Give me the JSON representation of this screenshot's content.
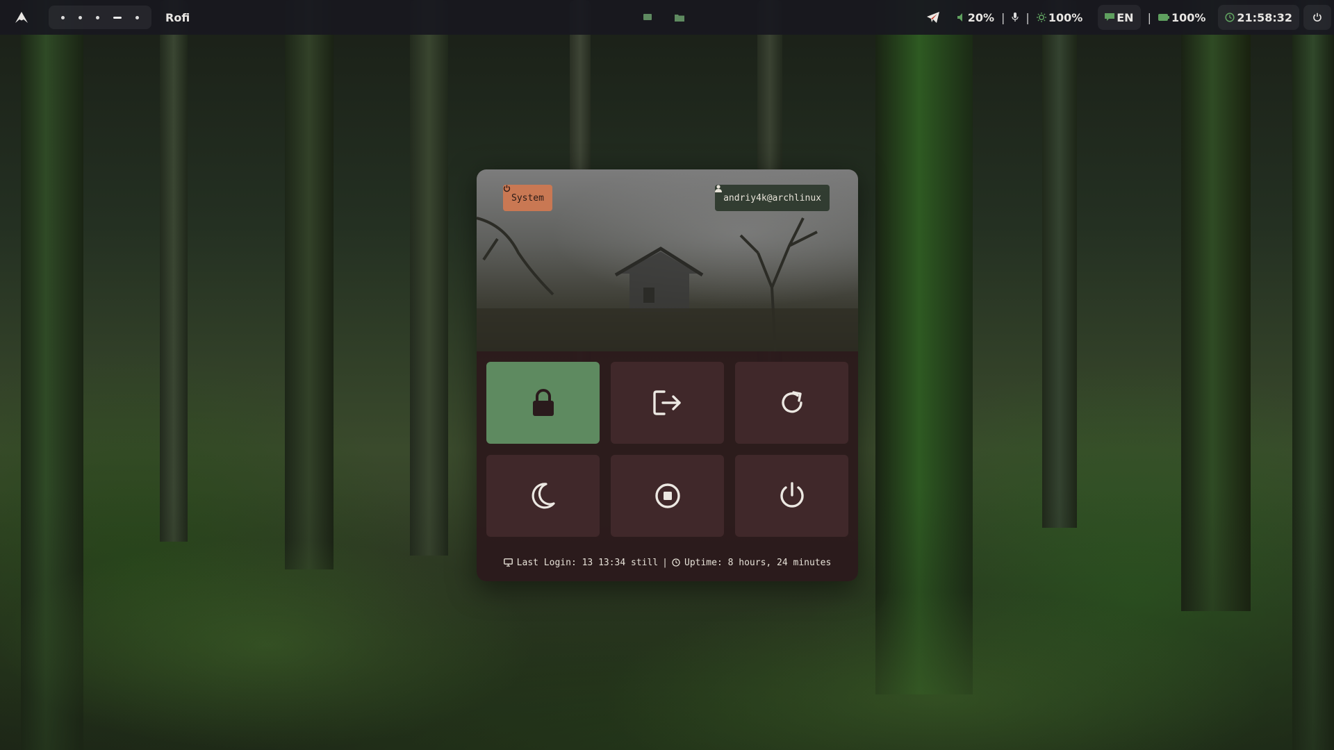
{
  "topbar": {
    "launcher_icon": "arch-linux-icon",
    "workspaces": [
      "dot",
      "dot",
      "dot",
      "active",
      "dot"
    ],
    "window_title": "Rofi",
    "tray": [
      "monitor-icon",
      "folder-icon"
    ],
    "telegram_icon": "telegram-icon",
    "volume": "20%",
    "mic_icon": "microphone-icon",
    "brightness": "100%",
    "keyboard_layout": "EN",
    "battery": "100%",
    "clock": "21:58:32",
    "power_icon": "power-icon",
    "separator": "|"
  },
  "menu": {
    "system_label": "System",
    "user_label": "andriy4k@archlinux",
    "buttons": [
      {
        "name": "lock",
        "icon": "lock-icon",
        "active": true
      },
      {
        "name": "logout",
        "icon": "logout-icon",
        "active": false
      },
      {
        "name": "reboot",
        "icon": "reboot-icon",
        "active": false
      },
      {
        "name": "suspend",
        "icon": "moon-icon",
        "active": false
      },
      {
        "name": "hibernate",
        "icon": "stop-circle-icon",
        "active": false
      },
      {
        "name": "shutdown",
        "icon": "power-icon",
        "active": false
      }
    ],
    "footer": {
      "last_login": "Last Login: 13 13:34 still",
      "separator": "|",
      "uptime": "Uptime: 8 hours, 24 minutes"
    }
  },
  "colors": {
    "accent_active": "#5e8a60",
    "system_chip": "#c97853",
    "tile": "#422a2c",
    "bar": "#181820"
  }
}
